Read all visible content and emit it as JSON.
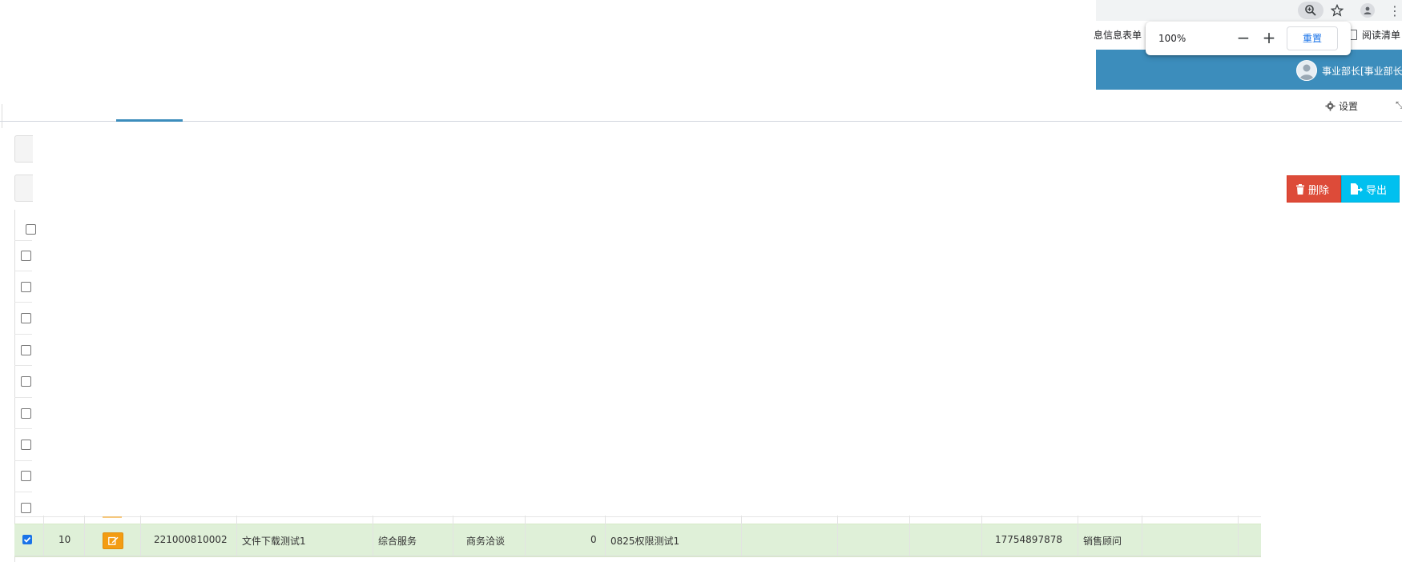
{
  "browser": {
    "zoom_icon": "zoom-in-icon",
    "star_icon": "star-icon",
    "profile_icon": "profile-icon",
    "menu_icon": "more-vert-icon",
    "bookmark_left": "息信息表单",
    "bookmark_right": "阅读清单",
    "zoom_popup": {
      "percent": "100%",
      "minus": "−",
      "plus": "+",
      "reset": "重置"
    }
  },
  "header": {
    "user": "事业部长[事业部长",
    "settings": "设置",
    "accent": "#3c8dbc"
  },
  "toolbar": {
    "delete_label": "删除",
    "export_label": "导出",
    "delete_color": "#dd4b39",
    "export_color": "#00c0ef"
  },
  "table": {
    "selected_row": {
      "index": "10",
      "code": "221000810002",
      "name": "文件下载测试1",
      "category": "综合服务",
      "stage": "商务洽谈",
      "count": "0",
      "project": "0825权限测试1",
      "phone": "17754897878",
      "role": "销售顾问"
    },
    "selected_row_color": "#dff0d8"
  }
}
